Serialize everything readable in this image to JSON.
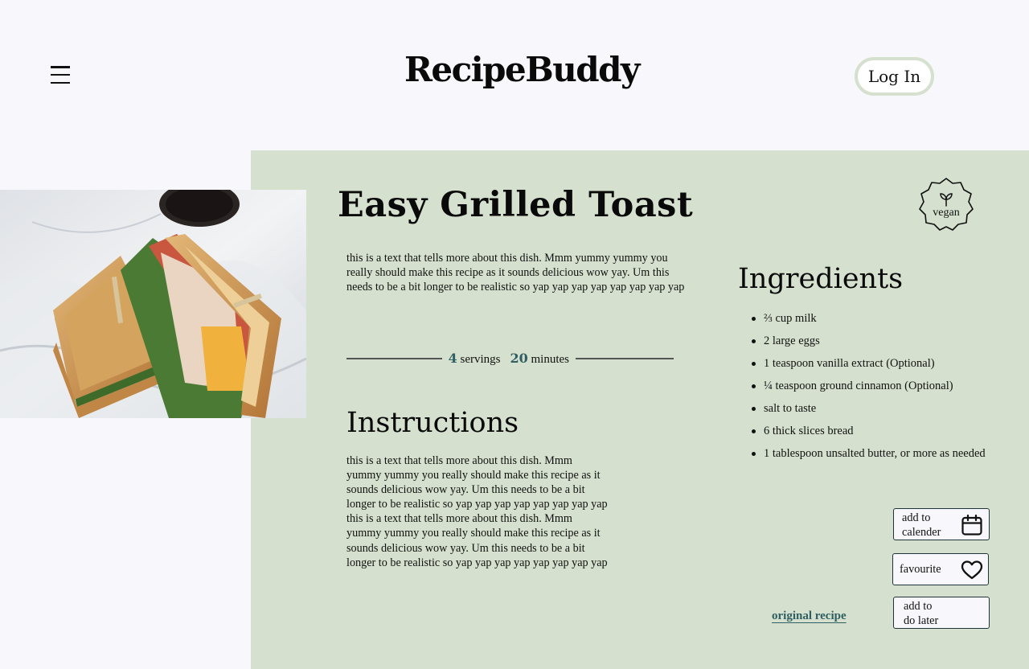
{
  "header": {
    "logo": "RecipeBuddy",
    "login_label": "Log In"
  },
  "recipe": {
    "title": "Easy Grilled Toast",
    "description": "this is a text that tells more about this dish. Mmm yummy yummy you really should make this recipe as it sounds delicious wow yay. Um this needs to be a bit longer to be realistic so yap yap yap yap yap yap yap yap",
    "servings": "4",
    "servings_label": "servings",
    "minutes": "20",
    "minutes_label": "minutes",
    "badge": "vegan"
  },
  "instructions": {
    "heading": "Instructions",
    "lines": [
      "this is a text that tells more about this dish. Mmm",
      "yummy yummy you really should make this recipe as it",
      "sounds delicious wow yay. Um this needs to be a bit",
      "longer to be realistic so yap yap yap yap yap  yap yap yap",
      "this is a text that tells more about this dish. Mmm",
      "yummy yummy you really should make this recipe as it",
      "sounds delicious wow yay. Um this needs to be a bit",
      "longer to be realistic so yap yap yap yap yap  yap yap yap"
    ]
  },
  "ingredients": {
    "heading": "Ingredients",
    "items": [
      "⅔ cup milk",
      "2 large eggs",
      "1 teaspoon vanilla extract (Optional)",
      "¼ teaspoon ground cinnamon (Optional)",
      "salt to taste",
      "6 thick slices bread",
      "1 tablespoon unsalted butter, or more as needed"
    ]
  },
  "actions": {
    "calendar": "add to\ncalender",
    "favourite": "favourite",
    "later": "add to\ndo later",
    "original": "original recipe"
  },
  "icons": {
    "menu": "hamburger-menu-icon",
    "calendar": "calendar-icon",
    "favourite": "heart-icon",
    "vegan": "leaf-sprout-icon"
  }
}
